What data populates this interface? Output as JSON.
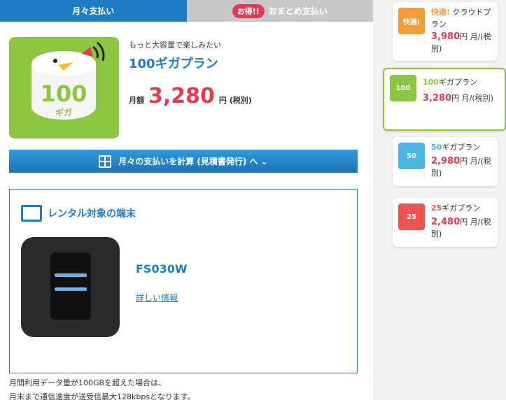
{
  "tabs": {
    "monthly": "月々支払い",
    "bulk_badge": "お得!!",
    "bulk": "おまとめ支払い"
  },
  "plan": {
    "image_number": "100",
    "image_unit": "ギガ",
    "subtitle": "もっと大容量で楽しみたい",
    "name": "100ギガプラン",
    "price_label": "月額",
    "price": "3,280",
    "price_unit": "円 (税別)",
    "color": "#8cc63f"
  },
  "calc_button": "月々の支払いを計算 (見積書発行) へ ⌄",
  "device": {
    "title": "レンタル対象の端末",
    "name": "FS030W",
    "link": "詳しい情報"
  },
  "note": {
    "line1": "月間利用データ量が100GBを超えた場合は、",
    "line2": "月末まで通信速度が送受信最大128kbpsとなります。"
  },
  "sidebar": [
    {
      "title_accent": "快適!",
      "title": " クラウドプラン",
      "price": "3,980",
      "unit": "円 月/(税別)",
      "thumb": "快適!",
      "color": "#f39c3c"
    },
    {
      "title_accent": "100",
      "title": "ギガプラン",
      "price": "3,280",
      "unit": "円 月/(税別)",
      "thumb": "100",
      "color": "#8cc63f"
    },
    {
      "title_accent": "50",
      "title": "ギガプラン",
      "price": "2,980",
      "unit": "円 月/(税別)",
      "thumb": "50",
      "color": "#4ab8e0"
    },
    {
      "title_accent": "25",
      "title": "ギガプラン",
      "price": "2,480",
      "unit": "円 月/(税別)",
      "thumb": "25",
      "color": "#ef5350"
    }
  ]
}
